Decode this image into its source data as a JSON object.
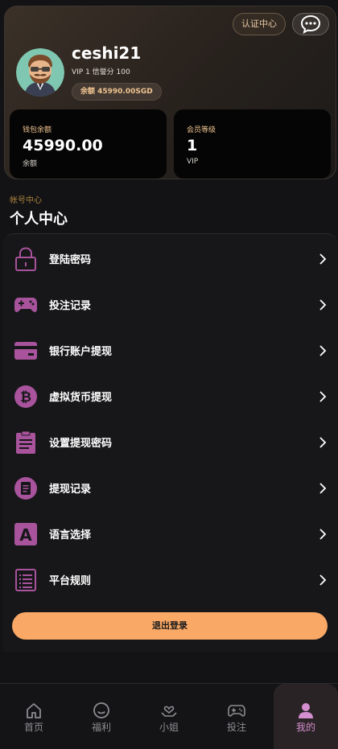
{
  "profile": {
    "cert_label": "认证中心",
    "username": "ceshi21",
    "vip_line": "VIP 1 信誉分 100",
    "balance_pill": "余额 45990.00SGD",
    "wallet": {
      "label": "钱包余额",
      "value": "45990.00",
      "sub": "余额"
    },
    "member": {
      "label": "会员等级",
      "value": "1",
      "sub": "VIP"
    }
  },
  "section": {
    "subtitle": "帐号中心",
    "title": "个人中心"
  },
  "menu": {
    "items": [
      {
        "label": "登陆密码",
        "icon": "lock-icon"
      },
      {
        "label": "投注记录",
        "icon": "gamepad-icon"
      },
      {
        "label": "银行账户提现",
        "icon": "bank-card-icon"
      },
      {
        "label": "虚拟货币提现",
        "icon": "bitcoin-icon"
      },
      {
        "label": "设置提现密码",
        "icon": "clipboard-icon"
      },
      {
        "label": "提现记录",
        "icon": "record-icon"
      },
      {
        "label": "语言选择",
        "icon": "language-icon"
      },
      {
        "label": "平台规则",
        "icon": "rules-list-icon"
      }
    ]
  },
  "logout_label": "退出登录",
  "tabs": [
    {
      "label": "首页",
      "icon": "home-icon"
    },
    {
      "label": "福利",
      "icon": "smile-icon"
    },
    {
      "label": "小姐",
      "icon": "heart-hand-icon"
    },
    {
      "label": "投注",
      "icon": "gamepad-icon"
    },
    {
      "label": "我的",
      "icon": "user-icon"
    }
  ],
  "colors": {
    "accent_purple": "#a8539c",
    "accent_orange": "#f9a866",
    "gold_text": "#f0c490",
    "active_tab": "#d48fd0"
  }
}
